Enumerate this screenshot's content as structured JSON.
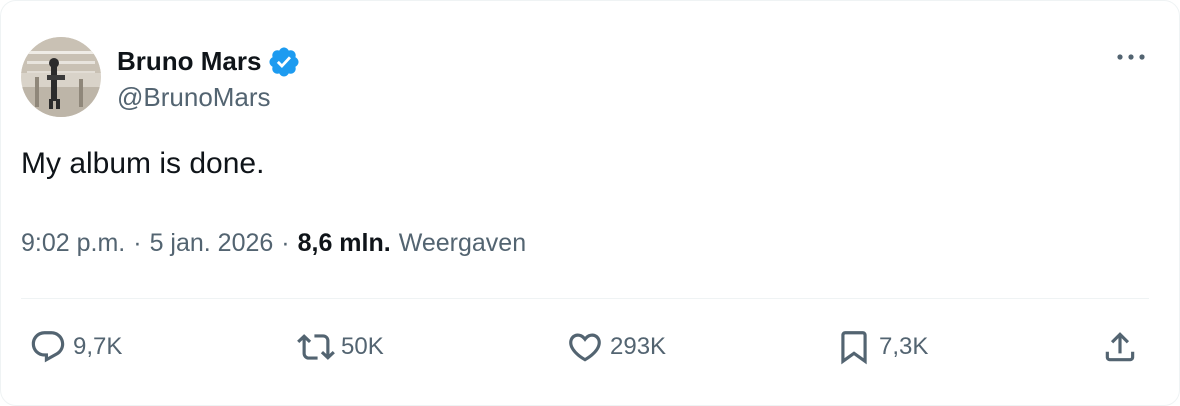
{
  "author": {
    "name": "Bruno Mars",
    "handle": "@BrunoMars",
    "verified": true
  },
  "tweet": {
    "text": "My album is done."
  },
  "meta": {
    "time": "9:02 p.m.",
    "separator": "·",
    "date": "5 jan. 2026",
    "views_count": "8,6 mln.",
    "views_label": "Weergaven"
  },
  "actions": {
    "reply_count": "9,7K",
    "retweet_count": "50K",
    "like_count": "293K",
    "bookmark_count": "7,3K"
  },
  "colors": {
    "verified": "#1d9bf0",
    "icon": "#536471",
    "text": "#0f1419",
    "secondary": "#536471"
  }
}
